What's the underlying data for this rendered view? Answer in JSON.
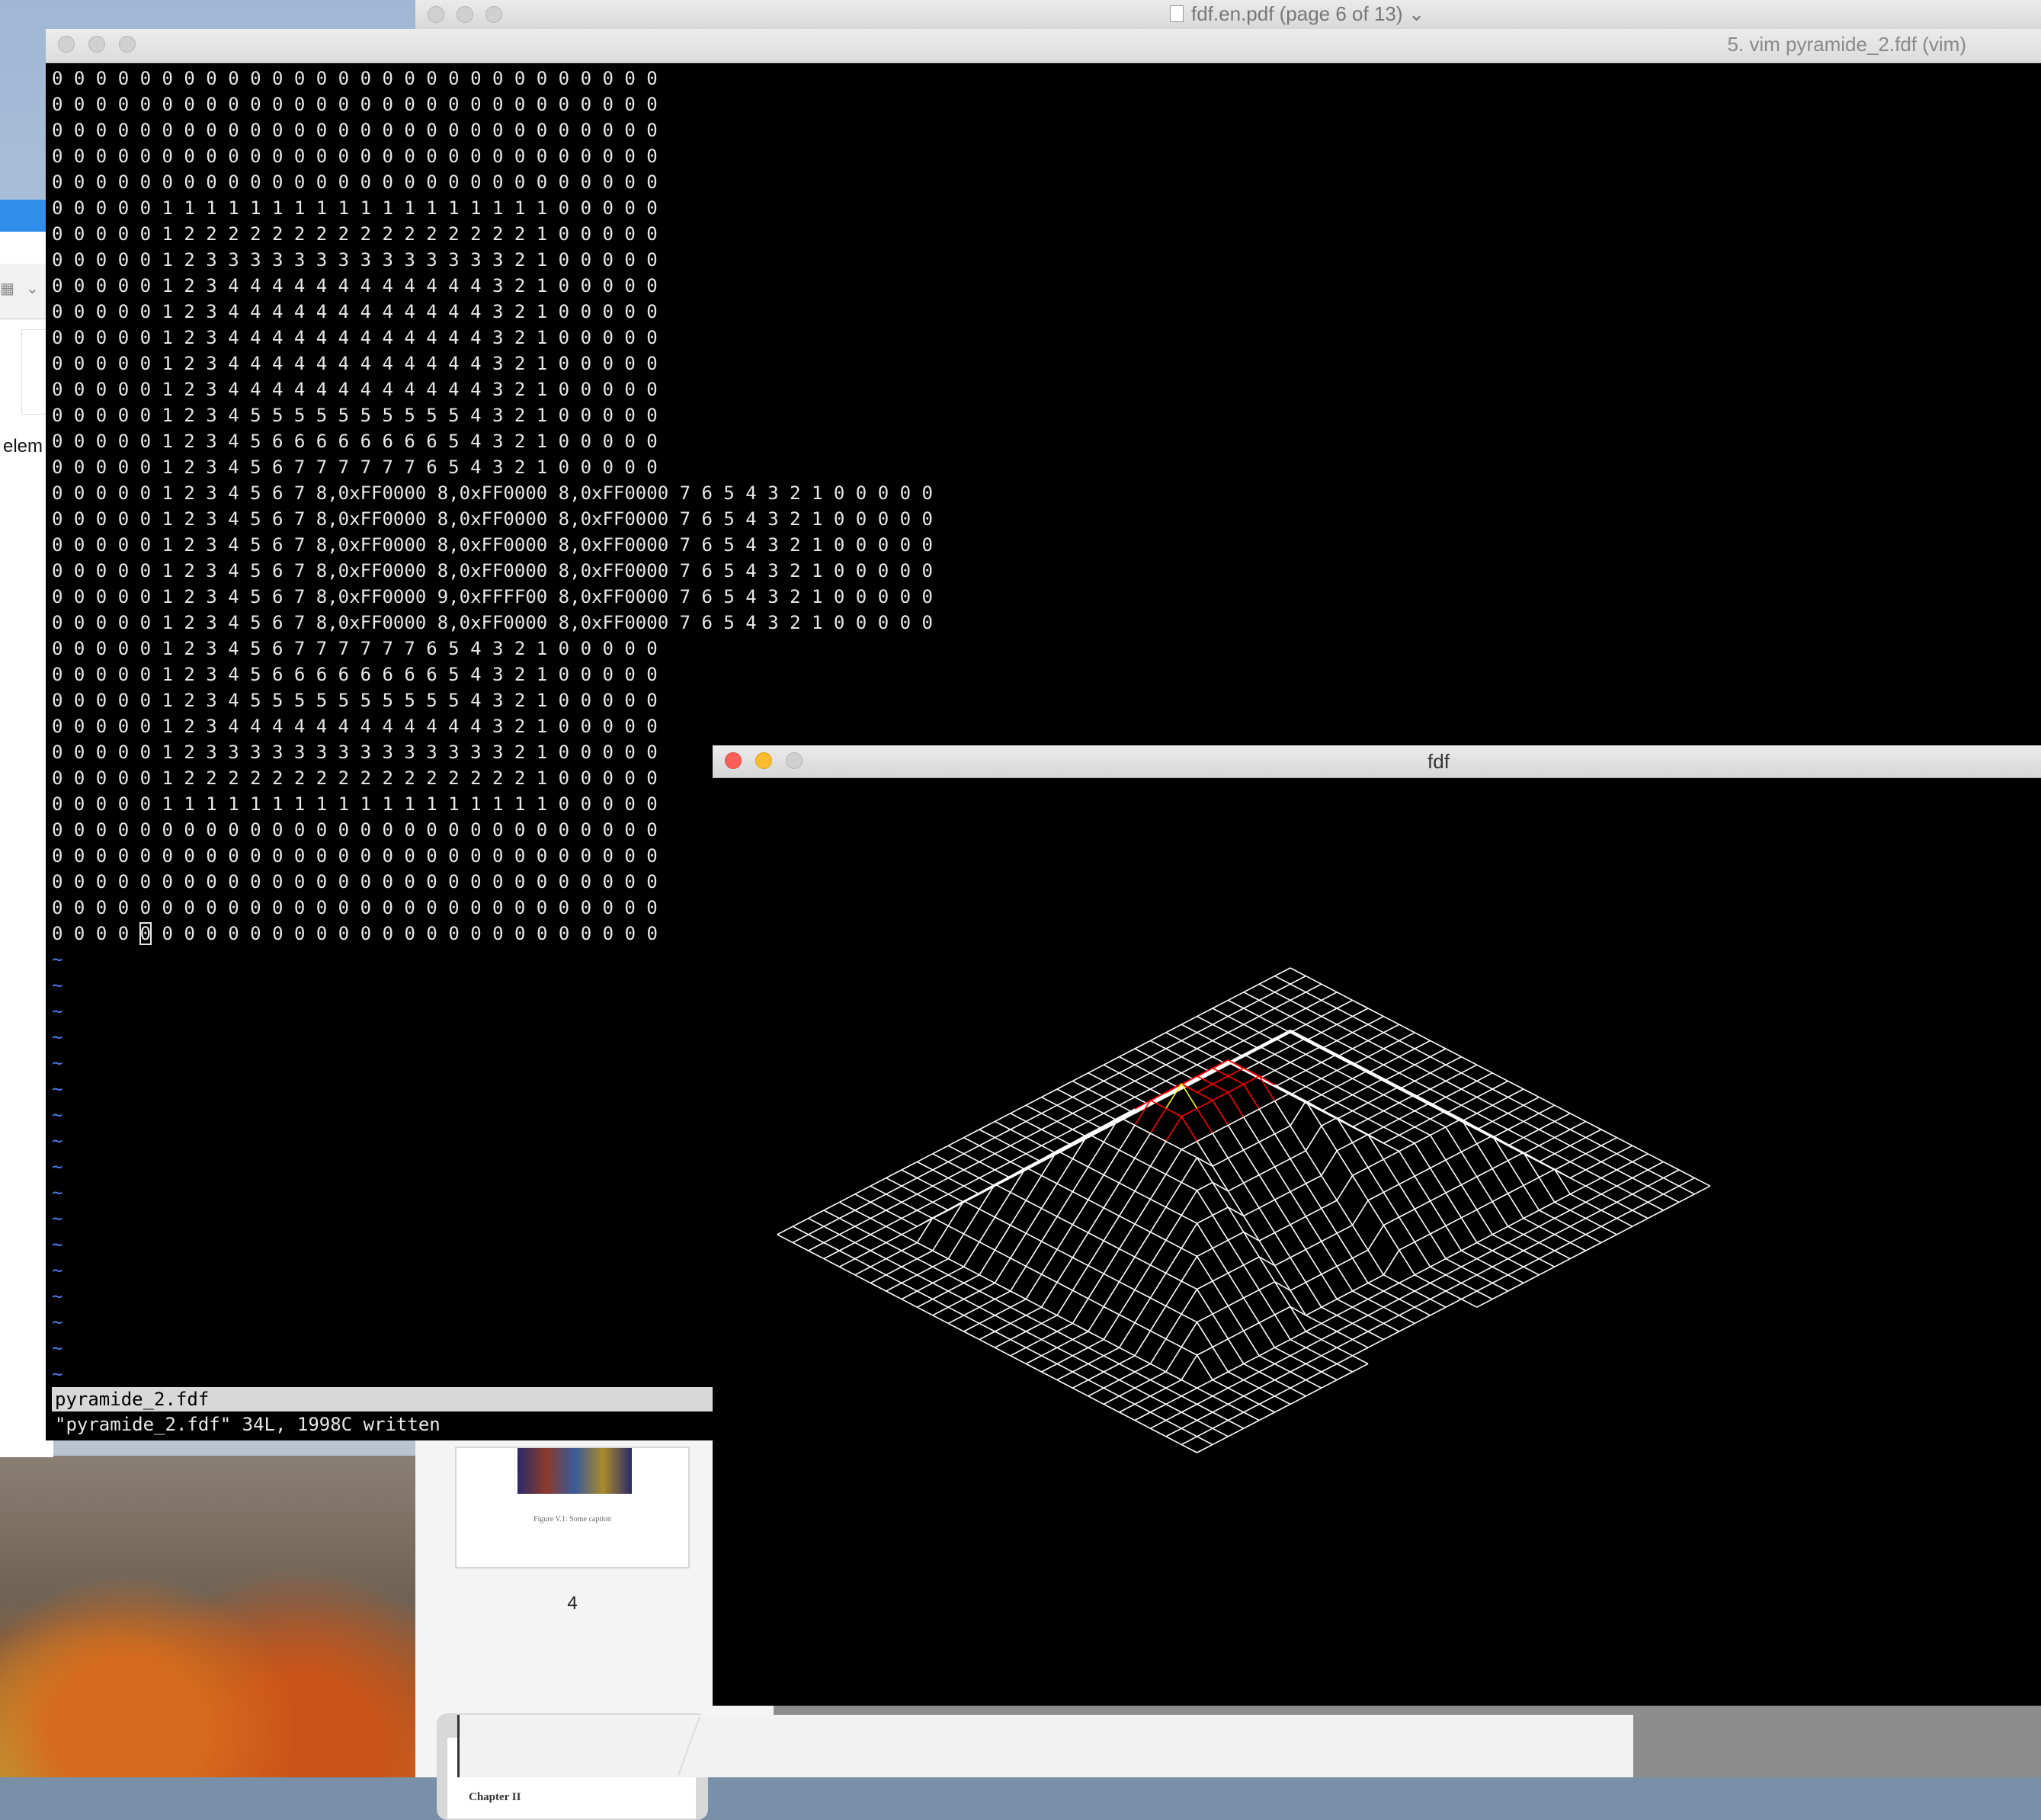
{
  "pdf_viewer": {
    "title": "fdf.en.pdf (page 6 of 13)",
    "title_chevron": "⌄",
    "thumbnail_caption": "Figure V.1: Some caption",
    "page_number": "4",
    "next_thumbnail_heading": "Chapter II"
  },
  "left_app": {
    "toolbar_icon": "▦",
    "toolbar_chevron": "⌄",
    "partial_text": "elem"
  },
  "terminal": {
    "title": "5. vim pyramide_2.fdf (vim)",
    "cursor": {
      "row": 33,
      "col": 4
    },
    "lines": [
      "0 0 0 0 0 0 0 0 0 0 0 0 0 0 0 0 0 0 0 0 0 0 0 0 0 0 0 0",
      "0 0 0 0 0 0 0 0 0 0 0 0 0 0 0 0 0 0 0 0 0 0 0 0 0 0 0 0",
      "0 0 0 0 0 0 0 0 0 0 0 0 0 0 0 0 0 0 0 0 0 0 0 0 0 0 0 0",
      "0 0 0 0 0 0 0 0 0 0 0 0 0 0 0 0 0 0 0 0 0 0 0 0 0 0 0 0",
      "0 0 0 0 0 0 0 0 0 0 0 0 0 0 0 0 0 0 0 0 0 0 0 0 0 0 0 0",
      "0 0 0 0 0 1 1 1 1 1 1 1 1 1 1 1 1 1 1 1 1 1 1 0 0 0 0 0",
      "0 0 0 0 0 1 2 2 2 2 2 2 2 2 2 2 2 2 2 2 2 2 1 0 0 0 0 0",
      "0 0 0 0 0 1 2 3 3 3 3 3 3 3 3 3 3 3 3 3 3 2 1 0 0 0 0 0",
      "0 0 0 0 0 1 2 3 4 4 4 4 4 4 4 4 4 4 4 4 3 2 1 0 0 0 0 0",
      "0 0 0 0 0 1 2 3 4 4 4 4 4 4 4 4 4 4 4 4 3 2 1 0 0 0 0 0",
      "0 0 0 0 0 1 2 3 4 4 4 4 4 4 4 4 4 4 4 4 3 2 1 0 0 0 0 0",
      "0 0 0 0 0 1 2 3 4 4 4 4 4 4 4 4 4 4 4 4 3 2 1 0 0 0 0 0",
      "0 0 0 0 0 1 2 3 4 4 4 4 4 4 4 4 4 4 4 4 3 2 1 0 0 0 0 0",
      "0 0 0 0 0 1 2 3 4 5 5 5 5 5 5 5 5 5 5 4 3 2 1 0 0 0 0 0",
      "0 0 0 0 0 1 2 3 4 5 6 6 6 6 6 6 6 6 5 4 3 2 1 0 0 0 0 0",
      "0 0 0 0 0 1 2 3 4 5 6 7 7 7 7 7 7 6 5 4 3 2 1 0 0 0 0 0",
      "0 0 0 0 0 1 2 3 4 5 6 7 8,0xFF0000 8,0xFF0000 8,0xFF0000 7 6 5 4 3 2 1 0 0 0 0 0",
      "0 0 0 0 0 1 2 3 4 5 6 7 8,0xFF0000 8,0xFF0000 8,0xFF0000 7 6 5 4 3 2 1 0 0 0 0 0",
      "0 0 0 0 0 1 2 3 4 5 6 7 8,0xFF0000 8,0xFF0000 8,0xFF0000 7 6 5 4 3 2 1 0 0 0 0 0",
      "0 0 0 0 0 1 2 3 4 5 6 7 8,0xFF0000 8,0xFF0000 8,0xFF0000 7 6 5 4 3 2 1 0 0 0 0 0",
      "0 0 0 0 0 1 2 3 4 5 6 7 8,0xFF0000 9,0xFFFF00 8,0xFF0000 7 6 5 4 3 2 1 0 0 0 0 0",
      "0 0 0 0 0 1 2 3 4 5 6 7 8,0xFF0000 8,0xFF0000 8,0xFF0000 7 6 5 4 3 2 1 0 0 0 0 0",
      "0 0 0 0 0 1 2 3 4 5 6 7 7 7 7 7 7 6 5 4 3 2 1 0 0 0 0 0",
      "0 0 0 0 0 1 2 3 4 5 6 6 6 6 6 6 6 6 5 4 3 2 1 0 0 0 0 0",
      "0 0 0 0 0 1 2 3 4 5 5 5 5 5 5 5 5 5 5 4 3 2 1 0 0 0 0 0",
      "0 0 0 0 0 1 2 3 4 4 4 4 4 4 4 4 4 4 4 4 3 2 1 0 0 0 0 0",
      "0 0 0 0 0 1 2 3 3 3 3 3 3 3 3 3 3 3 3 3 3 2 1 0 0 0 0 0",
      "0 0 0 0 0 1 2 2 2 2 2 2 2 2 2 2 2 2 2 2 2 2 1 0 0 0 0 0",
      "0 0 0 0 0 1 1 1 1 1 1 1 1 1 1 1 1 1 1 1 1 1 1 0 0 0 0 0",
      "0 0 0 0 0 0 0 0 0 0 0 0 0 0 0 0 0 0 0 0 0 0 0 0 0 0 0 0",
      "0 0 0 0 0 0 0 0 0 0 0 0 0 0 0 0 0 0 0 0 0 0 0 0 0 0 0 0",
      "0 0 0 0 0 0 0 0 0 0 0 0 0 0 0 0 0 0 0 0 0 0 0 0 0 0 0 0",
      "0 0 0 0 0 0 0 0 0 0 0 0 0 0 0 0 0 0 0 0 0 0 0 0 0 0 0 0",
      "0 0 0 0 0 0 0 0 0 0 0 0 0 0 0 0 0 0 0 0 0 0 0 0 0 0 0 0"
    ],
    "tilde_char": "~",
    "tilde_count": 17,
    "status_bar": "pyramide_2.fdf",
    "message": "\"pyramide_2.fdf\" 34L, 1998C written",
    "colors": {
      "tilde": "#4f7df0"
    }
  },
  "fdf_window": {
    "title": "fdf",
    "colors": {
      "default": "#ffffff",
      "highlight_red": "#ff0000",
      "highlight_yellow": "#ffff00"
    }
  }
}
